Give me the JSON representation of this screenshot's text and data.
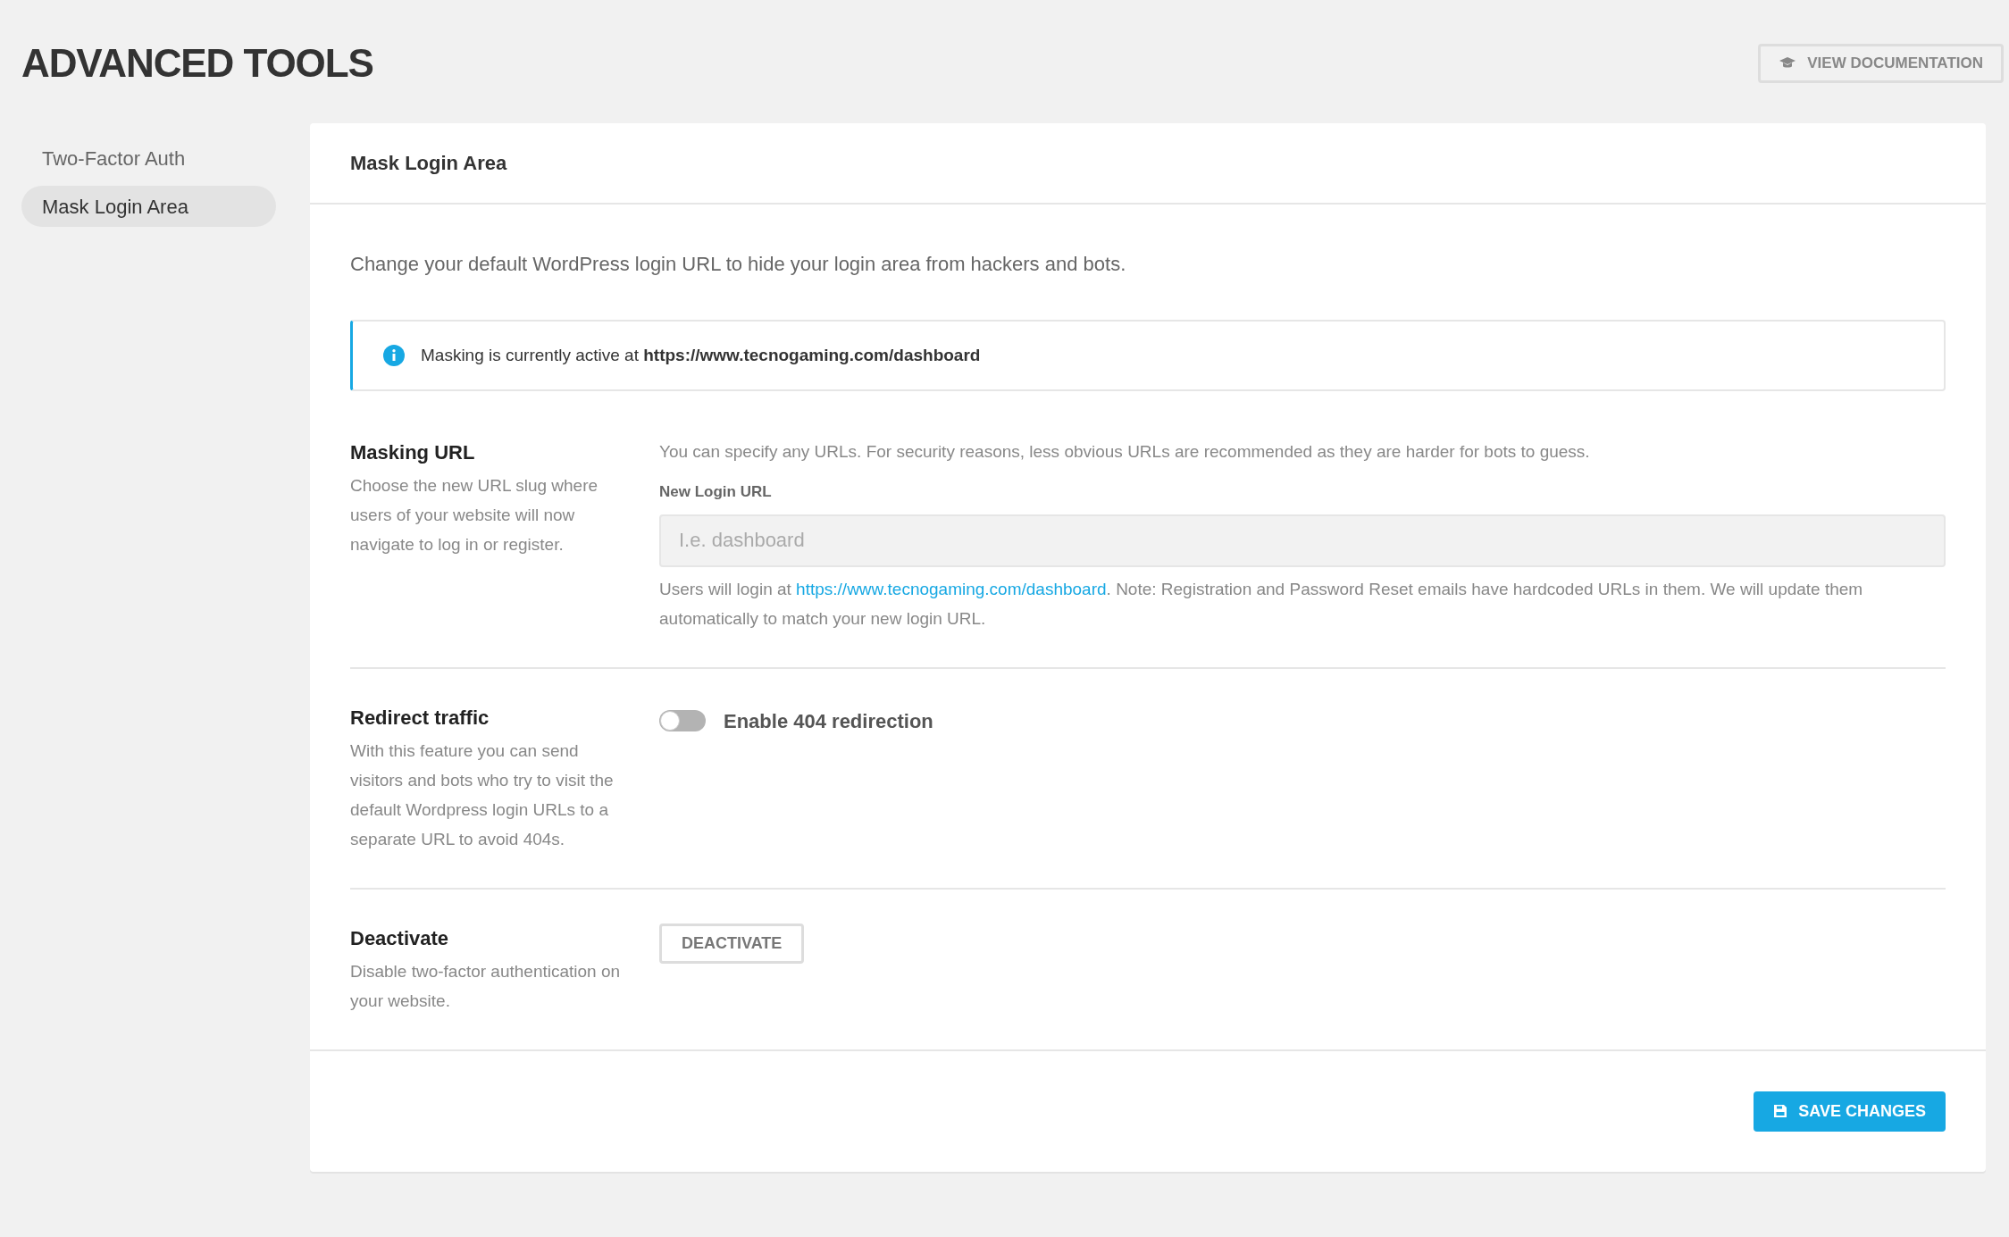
{
  "page_title": "ADVANCED TOOLS",
  "header_button": {
    "label": "VIEW DOCUMENTATION"
  },
  "sidebar": {
    "items": [
      {
        "label": "Two-Factor Auth",
        "selected": false
      },
      {
        "label": "Mask Login Area",
        "selected": true
      }
    ]
  },
  "panel": {
    "title": "Mask Login Area",
    "description": "Change your default WordPress login URL to hide your login area from hackers and bots.",
    "notice": {
      "text": "Masking is currently active at **https://www.tecnogaming.com/dashboard**"
    },
    "sections": [
      {
        "kind": "url",
        "title": "Masking URL",
        "description": "Choose the new URL slug where users of your website will now navigate to log in or register.",
        "hint": "You can specify any URLs. For security reasons, less obvious URLs are recommended as they are harder for bots to guess.",
        "field_label": "New Login URL",
        "placeholder": "I.e. dashboard",
        "note_before": "Users will login at ",
        "note_link": "https://www.tecnogaming.com/dashboard",
        "note_after": ". Note: Registration and Password Reset emails have hardcoded URLs in them. We will update them automatically to match your new login URL."
      },
      {
        "kind": "toggle",
        "title": "Redirect traffic",
        "description": "With this feature you can send visitors and bots who try to visit the default Wordpress login URLs to a separate URL to avoid 404s.",
        "toggle": {
          "label": "Enable 404 redirection",
          "on": false
        }
      },
      {
        "kind": "button",
        "title": "Deactivate",
        "description": "Disable two-factor authentication on your website.",
        "button": "DEACTIVATE"
      }
    ],
    "save_button": "SAVE CHANGES"
  }
}
